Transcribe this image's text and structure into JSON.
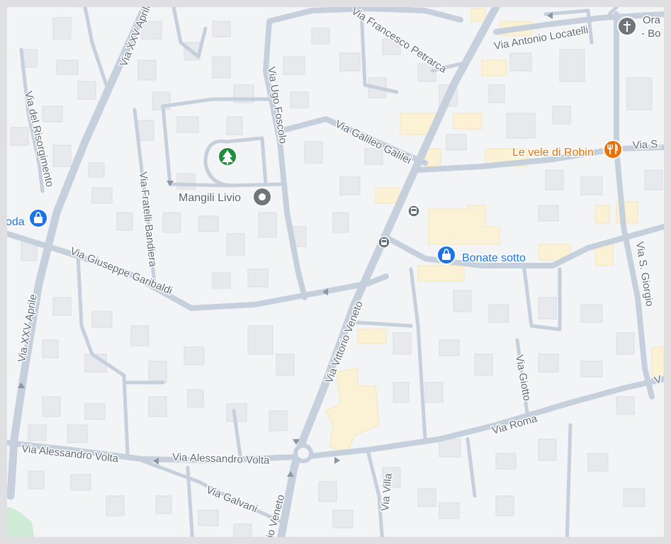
{
  "map": {
    "streets": {
      "petrarca": "Via Francesco Petrarca",
      "locatelli": "Via Antonio Locatelli",
      "xxv_aprile_top": "Via XXV Aprile",
      "xxv_aprile_left": "Via XXV Aprile",
      "risorgimento": "Via del Risorgimento",
      "foscolo": "Via Ugo Foscolo",
      "galilei": "Via Galileo Galilei",
      "bandiera": "Via Fratelli Bandiera",
      "garibaldi": "Via Giuseppe Garibaldi",
      "veneto": "Via Vittorio Veneto",
      "veneto_bottom": "rio Veneto",
      "roma": "Via Roma",
      "volta_left": "Via Alessandro Volta",
      "volta_right": "Via Alessandro Volta",
      "galvani": "Via Galvani",
      "villa": "Via Villa",
      "giotto": "Via Giotto",
      "sgiorgio": "Via S. Giorgio",
      "vias_right": "Via S.",
      "v_edge": "V"
    },
    "pois": {
      "mangili": "Mangili Livio",
      "bonate": "Bonate sotto",
      "vele": "Le vele di Robin",
      "shop_left": "oda",
      "church_line1": "Ora",
      "church_line2": "- Bo"
    },
    "colors": {
      "background": "#f3f4f6",
      "road": "#c5d0dc",
      "building": "#e8e9ed",
      "building_yellow": "#fbf2d6",
      "poi_blue": "#1a73e8",
      "poi_orange": "#e8710a",
      "poi_green": "#1e8e3e",
      "poi_gray": "#70757a",
      "street_label": "#5f6b78",
      "park": "#cdebd5"
    },
    "icons": {
      "park": "tree-icon",
      "place": "place-pin-icon",
      "shopping": "shopping-bag-icon",
      "restaurant": "fork-knife-icon",
      "church": "cross-icon",
      "bus": "bus-icon"
    }
  }
}
